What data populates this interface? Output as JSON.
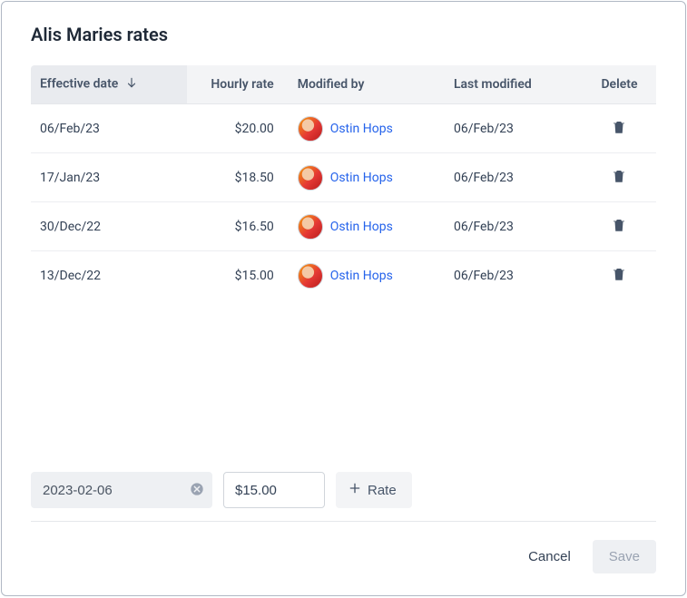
{
  "title": "Alis Maries rates",
  "columns": {
    "effective_date": "Effective date",
    "hourly_rate": "Hourly rate",
    "modified_by": "Modified by",
    "last_modified": "Last modified",
    "delete": "Delete"
  },
  "sort": {
    "column": "effective_date",
    "direction": "desc"
  },
  "rows": [
    {
      "effective_date": "06/Feb/23",
      "hourly_rate": "$20.00",
      "modified_by": "Ostin Hops",
      "last_modified": "06/Feb/23"
    },
    {
      "effective_date": "17/Jan/23",
      "hourly_rate": "$18.50",
      "modified_by": "Ostin Hops",
      "last_modified": "06/Feb/23"
    },
    {
      "effective_date": "30/Dec/22",
      "hourly_rate": "$16.50",
      "modified_by": "Ostin Hops",
      "last_modified": "06/Feb/23"
    },
    {
      "effective_date": "13/Dec/22",
      "hourly_rate": "$15.00",
      "modified_by": "Ostin Hops",
      "last_modified": "06/Feb/23"
    }
  ],
  "new_row": {
    "date_value": "2023-02-06",
    "rate_value": "$15.00",
    "add_label": "Rate"
  },
  "buttons": {
    "cancel": "Cancel",
    "save": "Save"
  }
}
